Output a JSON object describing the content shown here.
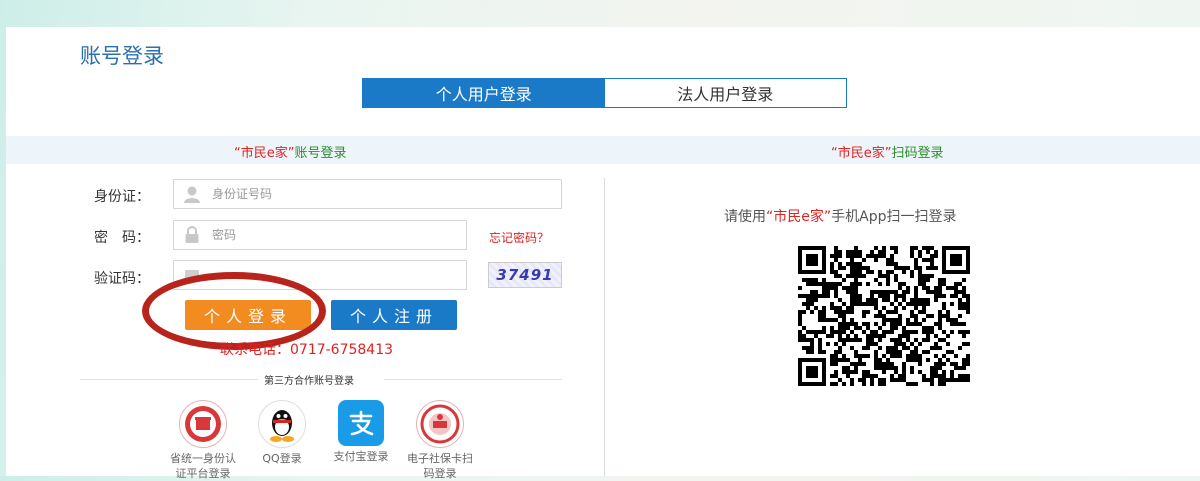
{
  "page": {
    "title": "账号登录"
  },
  "tabs": [
    {
      "label": "个人用户登录",
      "active": true
    },
    {
      "label": "法人用户登录",
      "active": false
    }
  ],
  "band": {
    "left": {
      "highlight": "“市民e家”",
      "rest": "账号登录"
    },
    "right": {
      "highlight": "“市民e家”",
      "rest": "扫码登录"
    }
  },
  "form": {
    "id_label": "身份证：",
    "id_placeholder": "身份证号码",
    "password_label": "密　码：",
    "password_placeholder": "密码",
    "forgot_label": "忘记密码？",
    "captcha_label": "验证码：",
    "captcha_value": "",
    "captcha_image_text": "37491",
    "login_button": "个人登录",
    "register_button": "个人注册",
    "phone_text": "联系电话：0717-6758413"
  },
  "third_party": {
    "title": "第三方合作账号登录",
    "providers": [
      {
        "label": "省统一身份认证平台登录",
        "icon": "seal-icon"
      },
      {
        "label": "QQ登录",
        "icon": "qq-penguin-icon"
      },
      {
        "label": "支付宝登录",
        "icon": "alipay-icon"
      },
      {
        "label": "电子社保卡扫码登录",
        "icon": "social-security-card-icon"
      }
    ]
  },
  "qr": {
    "prefix": "请使用",
    "highlight": "“市民e家”",
    "suffix": "手机App扫一扫登录"
  },
  "colors": {
    "brand_blue": "#1a7ac8",
    "login_orange": "#f28b20",
    "highlight_red": "#dd2222",
    "band_green": "#2e8b2e",
    "annotation_circle": "#b8231c"
  }
}
